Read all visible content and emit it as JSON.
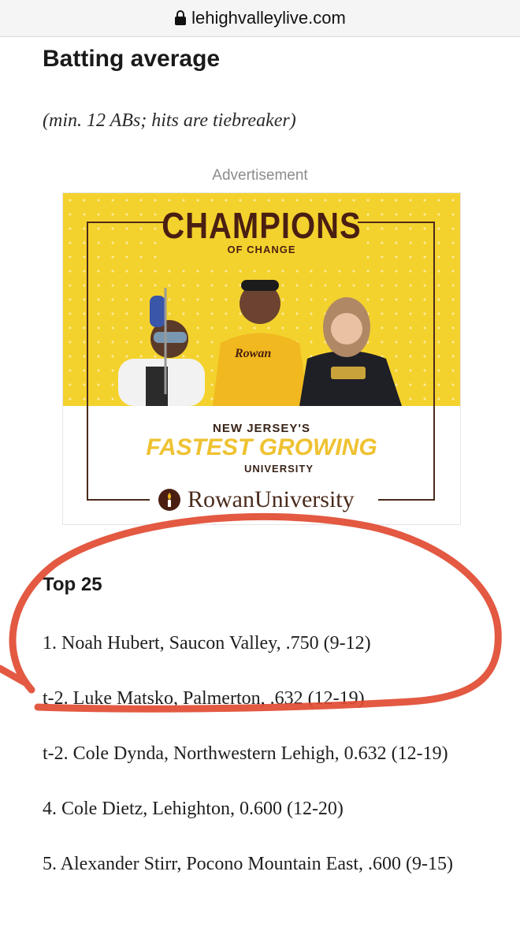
{
  "browser": {
    "url": "lehighvalleylive.com",
    "lock_icon": "lock-icon"
  },
  "article": {
    "heading": "Batting average",
    "note": "(min. 12 ABs; hits are tiebreaker)",
    "ad_label": "Advertisement",
    "ad": {
      "title": "CHAMPIONS",
      "subtitle": "OF CHANGE",
      "line1": "NEW JERSEY'S",
      "line2": "FASTEST GROWING",
      "line3": "UNIVERSITY",
      "logo_text": "RowanUniversity",
      "colors": {
        "yellow": "#f4d22d",
        "brown": "#4a1f12",
        "gold_text": "#efc232"
      }
    },
    "top_heading": "Top 25",
    "rankings": [
      "1. Noah Hubert, Saucon Valley, .750 (9-12)",
      "t-2. Luke Matsko, Palmerton, .632 (12-19)",
      "t-2. Cole Dynda, Northwestern Lehigh, 0.632 (12-19)",
      "4. Cole Dietz, Lehighton, 0.600 (12-20)",
      "5. Alexander Stirr, Pocono Mountain East, .600 (9-15)"
    ]
  },
  "annotation": {
    "color": "#e0472e"
  }
}
